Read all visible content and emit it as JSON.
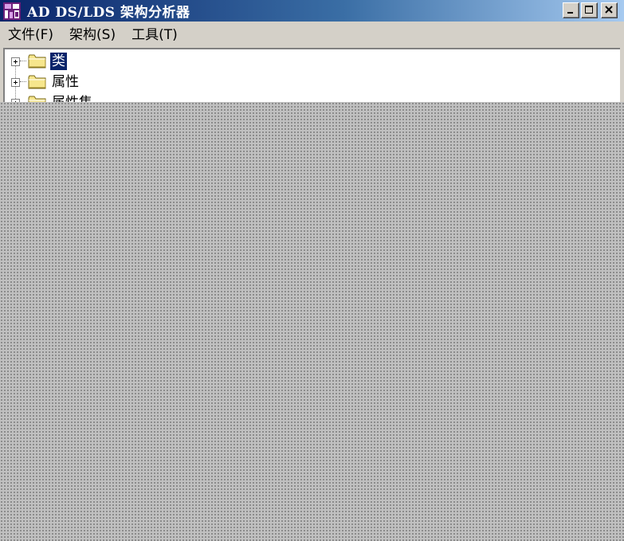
{
  "window": {
    "title": "AD DS/LDS 架构分析器",
    "icon": "schema-analyzer-app-icon",
    "buttons": {
      "minimize": "minimize-icon",
      "maximize": "maximize-icon",
      "close": "close-icon"
    }
  },
  "menu": {
    "items": [
      {
        "label": "文件(F)"
      },
      {
        "label": "架构(S)"
      },
      {
        "label": "工具(T)"
      }
    ]
  },
  "tree": {
    "nodes": [
      {
        "label": "类",
        "selected": true,
        "icon": "folder-icon"
      },
      {
        "label": "属性",
        "selected": false,
        "icon": "folder-icon"
      },
      {
        "label": "属性集",
        "selected": false,
        "icon": "folder-icon"
      }
    ]
  },
  "colors": {
    "titlebar_start": "#0a246a",
    "titlebar_end": "#a6caf0",
    "window_face": "#d4d0c8",
    "selection": "#0a246a"
  }
}
